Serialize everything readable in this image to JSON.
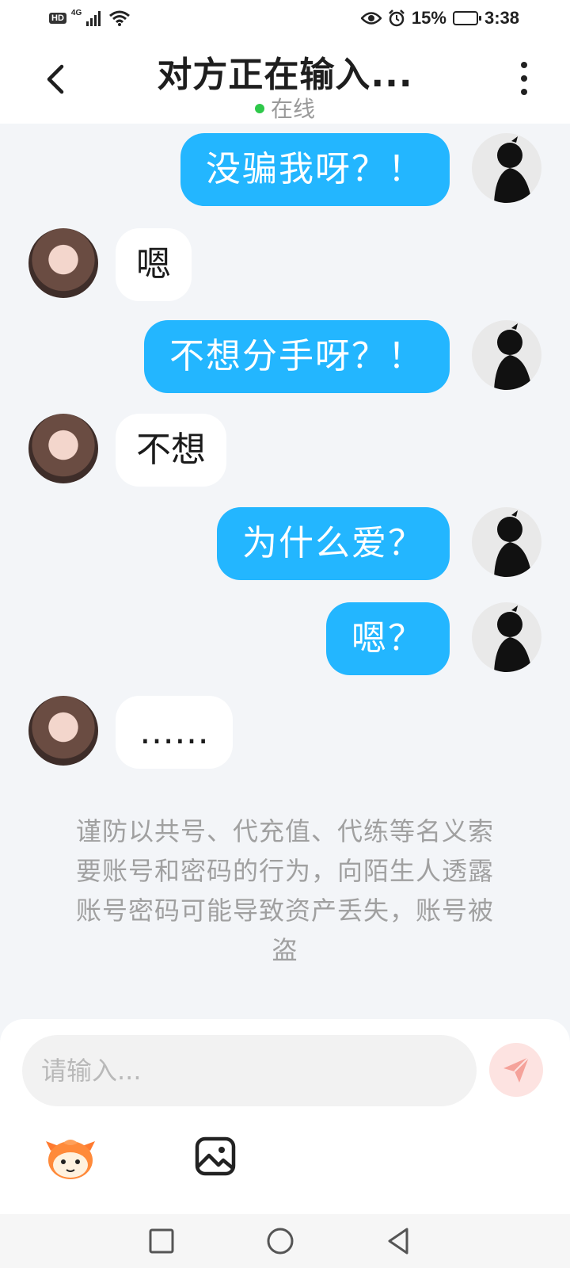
{
  "status_bar": {
    "hd": "HD",
    "network": "4G",
    "battery_percent": "15%",
    "time": "3:38"
  },
  "header": {
    "title": "对方正在输入...",
    "status": "在线",
    "status_color": "#2ec84a"
  },
  "messages": [
    {
      "side": "me",
      "text": "没骗我呀？！"
    },
    {
      "side": "her",
      "text": "嗯"
    },
    {
      "side": "me",
      "text": "不想分手呀？！"
    },
    {
      "side": "her",
      "text": "不想"
    },
    {
      "side": "me",
      "text": "为什么爱？"
    },
    {
      "side": "me",
      "text": "嗯？"
    },
    {
      "side": "her",
      "text": "……"
    }
  ],
  "notice": "谨防以共号、代充值、代练等名义索要账号和密码的行为，向陌生人透露账号密码可能导致资产丢失，账号被盗",
  "input": {
    "placeholder": "请输入..."
  },
  "colors": {
    "my_bubble": "#23b6ff",
    "her_bubble": "#ffffff",
    "background": "#f3f5f8",
    "send_button": "#fde3e1",
    "send_icon": "#f5a29a"
  },
  "icons": {
    "back": "chevron-left-icon",
    "more": "more-vertical-icon",
    "send": "paper-plane-icon",
    "emoji": "emoji-mascot-icon",
    "image": "image-icon",
    "nav_recent": "square-icon",
    "nav_home": "circle-icon",
    "nav_back": "triangle-back-icon"
  }
}
